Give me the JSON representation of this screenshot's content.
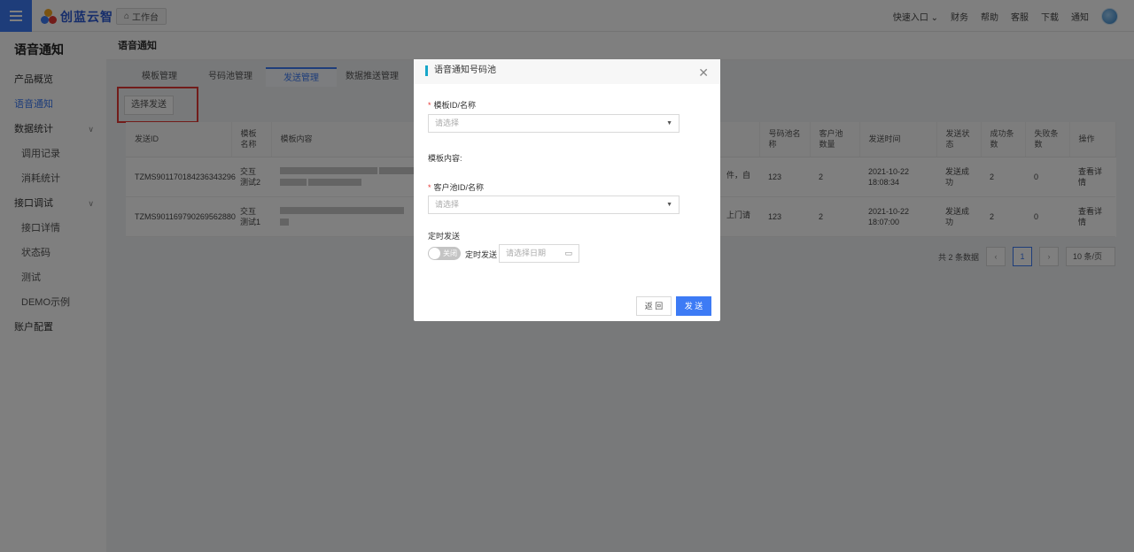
{
  "header": {
    "brand": "创蓝云智",
    "workbench": "工作台",
    "quick_entry": "快速入口",
    "links": [
      "财务",
      "帮助",
      "客服",
      "下载",
      "通知"
    ]
  },
  "sidebar": {
    "title": "语音通知",
    "items": [
      {
        "label": "产品概览"
      },
      {
        "label": "语音通知"
      },
      {
        "label": "数据统计"
      },
      {
        "label": "调用记录"
      },
      {
        "label": "消耗统计"
      },
      {
        "label": "接口调试"
      },
      {
        "label": "接口详情"
      },
      {
        "label": "状态码"
      },
      {
        "label": "测试"
      },
      {
        "label": "DEMO示例"
      },
      {
        "label": "账户配置"
      }
    ]
  },
  "page": {
    "title": "语音通知",
    "tabs": [
      "模板管理",
      "号码池管理",
      "发送管理",
      "数据推送管理"
    ],
    "select_send": "选择发送"
  },
  "table": {
    "headers": [
      "发送ID",
      "模板名称",
      "模板内容",
      "号码池名称",
      "客户池数量",
      "发送时间",
      "发送状态",
      "成功条数",
      "失败条数",
      "操作"
    ],
    "rows": [
      {
        "id": "TZMS901170184236343296",
        "name": "交互测试2",
        "content_tail": "件，自",
        "pool": "123",
        "count": "2",
        "time": "2021-10-22 18:08:34",
        "status": "发送成功",
        "success": "2",
        "fail": "0",
        "action": "查看详情"
      },
      {
        "id": "TZMS901169790269562880",
        "name": "交互测试1",
        "content_tail": "上门请",
        "pool": "123",
        "count": "2",
        "time": "2021-10-22 18:07:00",
        "status": "发送成功",
        "success": "2",
        "fail": "0",
        "action": "查看详情"
      }
    ]
  },
  "pagination": {
    "total": "共 2 条数据",
    "current": "1",
    "page_size": "10 条/页"
  },
  "modal": {
    "title": "语音通知号码池",
    "template_label": "模板ID/名称",
    "template_placeholder": "请选择",
    "content_label": "模板内容:",
    "pool_label": "客户池ID/名称",
    "pool_placeholder": "请选择",
    "schedule_label": "定时发送",
    "toggle_label": "关闭",
    "timed_send_label": "定时发送",
    "date_placeholder": "请选择日期",
    "back_button": "返 回",
    "send_button": "发 送"
  }
}
